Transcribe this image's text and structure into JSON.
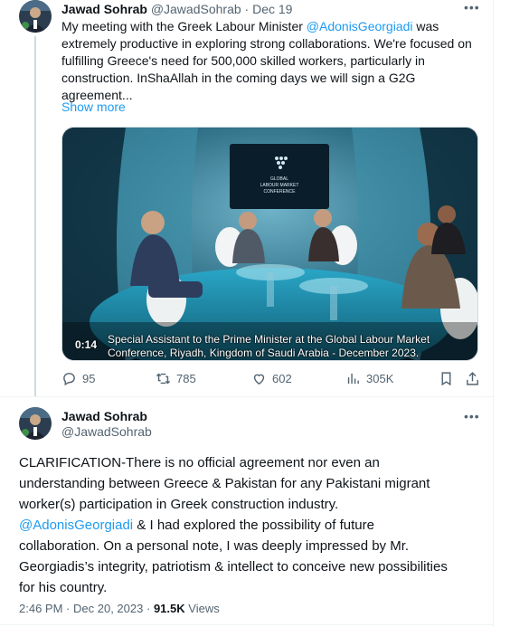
{
  "tweet1": {
    "author_name": "Jawad Sohrab",
    "author_handle": "@JawadSohrab",
    "separator": "·",
    "date": "Dec 19",
    "more_icon": "more-dots-icon",
    "text_lines": [
      {
        "before": "My meeting with the Greek Labour Minister ",
        "mention": "@AdonisGeorgiadi",
        "after": " was"
      },
      {
        "text": "extremely productive in exploring strong collaborations. We're focused on"
      },
      {
        "text": "fulfilling Greece's need for 500,000 skilled workers, particularly in"
      },
      {
        "text": "construction. InShaAllah in the coming days we will sign a G2G"
      },
      {
        "text": "agreement..."
      }
    ],
    "show_more": "Show more",
    "video": {
      "time": "0:14",
      "caption_line1": "Special Assistant to the Prime Minister at the Global Labour Market",
      "caption_line2": "Conference, Riyadh, Kingdom of Saudi Arabia - December 2023.",
      "screen_line1": "GLOBAL",
      "screen_line2": "LABOUR MARKET",
      "screen_line3": "CONFERENCE"
    },
    "actions": {
      "replies": "95",
      "reposts": "785",
      "likes": "602",
      "views": "305K"
    }
  },
  "tweet2": {
    "author_name": "Jawad Sohrab",
    "author_handle": "@JawadSohrab",
    "more_icon": "more-dots-icon",
    "text_lines": [
      {
        "text": "CLARIFICATION-There is no official agreement nor even an"
      },
      {
        "text": "understanding between Greece & Pakistan for any Pakistani migrant"
      },
      {
        "text": "worker(s) participation in Greek construction industry."
      },
      {
        "mention": "@AdonisGeorgiadi",
        "after": " & I had explored the possibility of future"
      },
      {
        "text": "collaboration. On a personal note, I was deeply impressed by Mr."
      },
      {
        "text": "Georgiadis’s integrity, patriotism & intellect to conceive new possibilities"
      },
      {
        "text": "for his country."
      }
    ],
    "meta": {
      "time": "2:46 PM",
      "separator": "·",
      "date": "Dec 20, 2023",
      "views_count": "91.5K",
      "views_label": "Views"
    }
  },
  "colors": {
    "link": "#1d9bf0",
    "text": "#0f1419",
    "muted": "#536471",
    "border": "#eff3f4"
  }
}
